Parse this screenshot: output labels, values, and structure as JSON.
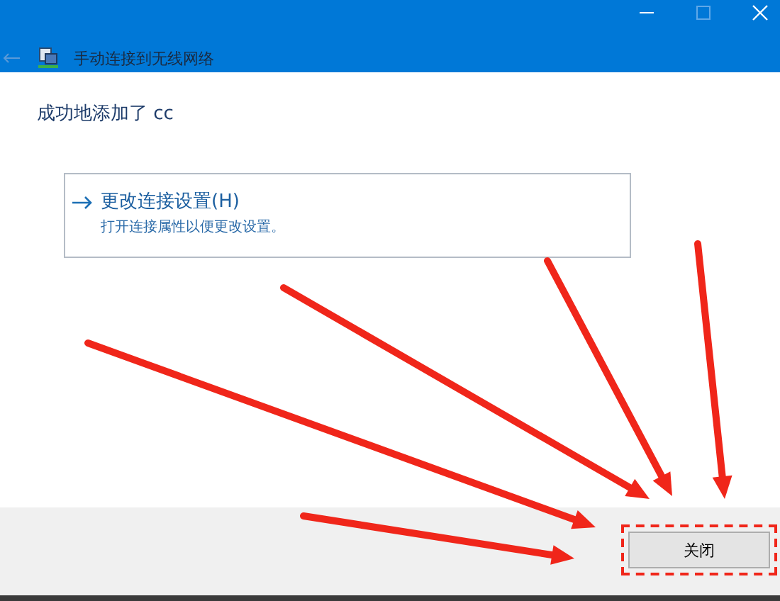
{
  "window": {
    "title": "手动连接到无线网络"
  },
  "heading": "成功地添加了 cc",
  "option": {
    "title": "更改连接设置(H)",
    "description": "打开连接属性以便更改设置。"
  },
  "buttons": [
    {
      "label": "关闭",
      "highlighted": true
    }
  ]
}
